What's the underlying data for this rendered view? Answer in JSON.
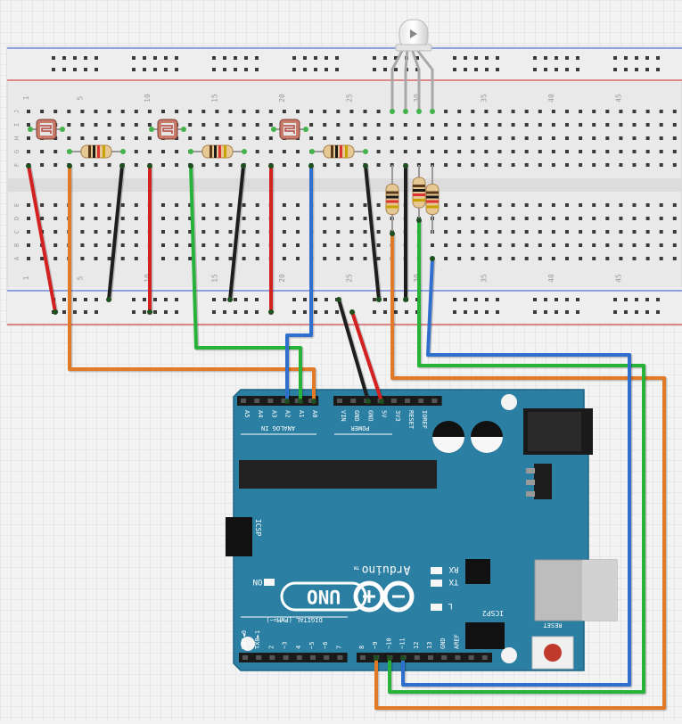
{
  "breadboard": {
    "column_numbers": [
      "1",
      "5",
      "10",
      "15",
      "20",
      "25",
      "30",
      "35",
      "40",
      "45"
    ],
    "row_letters_top": [
      "J",
      "I",
      "H",
      "G",
      "F"
    ],
    "row_letters_bottom": [
      "E",
      "D",
      "C",
      "B",
      "A"
    ]
  },
  "arduino": {
    "logo_text": "Arduino",
    "logo_tm": "TM",
    "model": "UNO",
    "on_label": "ON",
    "rx_label": "RX",
    "tx_label": "TX",
    "l_label": "L",
    "reset_label": "RESET",
    "icsp_label": "ICSP",
    "icsp2_label": "ICSP2",
    "analog_header": "ANALOG IN",
    "power_header": "POWER",
    "digital_header": "DIGITAL (PWM=~)",
    "analog_pins": [
      "A5",
      "A4",
      "A3",
      "A2",
      "A1",
      "A0"
    ],
    "power_pins": [
      "VIN",
      "GND",
      "GND",
      "5V",
      "3V3",
      "RESET",
      "IOREF"
    ],
    "digital_pins_left": [
      "RX0◄0",
      "TX0►1",
      "2",
      "~3",
      "4",
      "~5",
      "~6",
      "7"
    ],
    "digital_pins_right": [
      "8",
      "~9",
      "~10",
      "~11",
      "12",
      "13",
      "GND",
      "AREF"
    ]
  },
  "colors": {
    "board": "#2b7fa3",
    "wire_red": "#d32020",
    "wire_black": "#1e1e1e",
    "wire_orange": "#e07a26",
    "wire_green": "#27b33a",
    "wire_blue": "#2f6fce"
  }
}
